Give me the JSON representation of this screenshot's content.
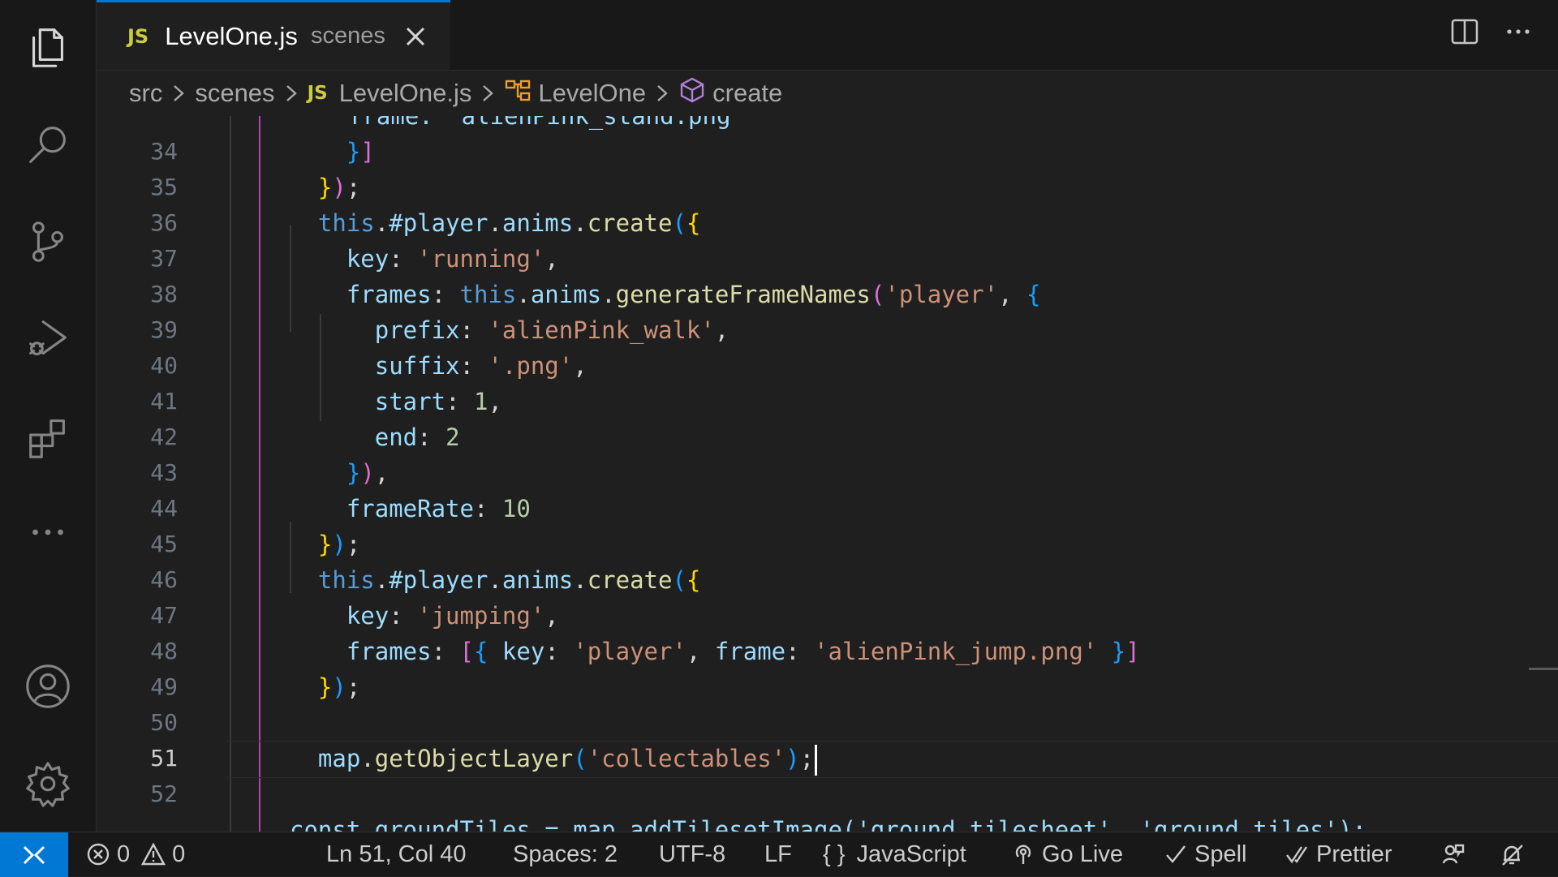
{
  "tab": {
    "badge": "JS",
    "filename": "LevelOne.js",
    "directory": "scenes"
  },
  "breadcrumbs": {
    "root": "src",
    "folder": "scenes",
    "file_badge": "JS",
    "file": "LevelOne.js",
    "class": "LevelOne",
    "method": "create"
  },
  "editor": {
    "current_line": 51,
    "top_partial_text": "frame: 'alienPink_stand.png'",
    "bottom_partial_text": "const groundTiles = map.addTilesetImage('ground_tilesheet', 'ground_tiles');",
    "line_numbers": [
      "34",
      "35",
      "36",
      "37",
      "38",
      "39",
      "40",
      "41",
      "42",
      "43",
      "44",
      "45",
      "46",
      "47",
      "48",
      "49",
      "50",
      "51",
      "52"
    ]
  },
  "status": {
    "errors": "0",
    "warnings": "0",
    "position": "Ln 51, Col 40",
    "spaces": "Spaces: 2",
    "encoding": "UTF-8",
    "eol": "LF",
    "language_icon": "{ }",
    "language": "JavaScript",
    "go_live": "Go Live",
    "spell": "Spell",
    "prettier": "Prettier"
  },
  "colors": {
    "accent": "#0078d4",
    "keyword": "#569cd6",
    "function": "#dcdcaa",
    "string": "#ce9178",
    "number": "#b5cea8",
    "property": "#9cdcfe",
    "bracket_gold": "#ffd700",
    "bracket_orchid": "#da70d6",
    "bracket_blue": "#179fff"
  }
}
